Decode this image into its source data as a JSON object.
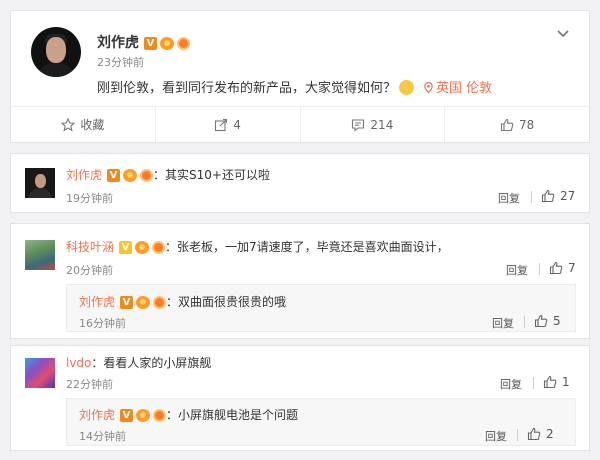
{
  "post": {
    "author": "刘作虎",
    "time": "23分钟前",
    "text": "刚到伦敦，看到同行发布的新产品，大家觉得如何？",
    "location": "英国 伦敦",
    "actions": {
      "favorite_label": "收藏",
      "share_count": "4",
      "comment_count": "214",
      "like_count": "78"
    }
  },
  "comments": [
    {
      "author": "刘作虎",
      "text": "：其实S10+还可以啦",
      "time": "19分钟前",
      "reply_label": "回复",
      "likes": "27"
    },
    {
      "author": "科技叶涵",
      "text": "：张老板，一加7请速度了，毕竟还是喜欢曲面设计，",
      "time": "20分钟前",
      "reply_label": "回复",
      "likes": "7",
      "reply": {
        "author": "刘作虎",
        "text": "：双曲面很贵很贵的哦",
        "time": "16分钟前",
        "reply_label": "回复",
        "likes": "5"
      }
    },
    {
      "author": "lvdo",
      "text": "：看看人家的小屏旗舰",
      "time": "22分钟前",
      "reply_label": "回复",
      "likes": "1",
      "reply": {
        "author": "刘作虎",
        "text": "：小屏旗舰电池是个问题",
        "time": "14分钟前",
        "reply_label": "回复",
        "likes": "2"
      }
    }
  ],
  "icons": {
    "verified": "V",
    "chevron": "chevron-down-icon",
    "favorite": "star-outline-icon",
    "share": "share-icon",
    "comment": "comment-icon",
    "like": "thumbs-up-icon",
    "location": "location-pin-icon"
  },
  "colors": {
    "accent": "#eb7350",
    "verified": "#f08a1e",
    "verified_alt": "#f5c52a",
    "muted": "#888888"
  }
}
